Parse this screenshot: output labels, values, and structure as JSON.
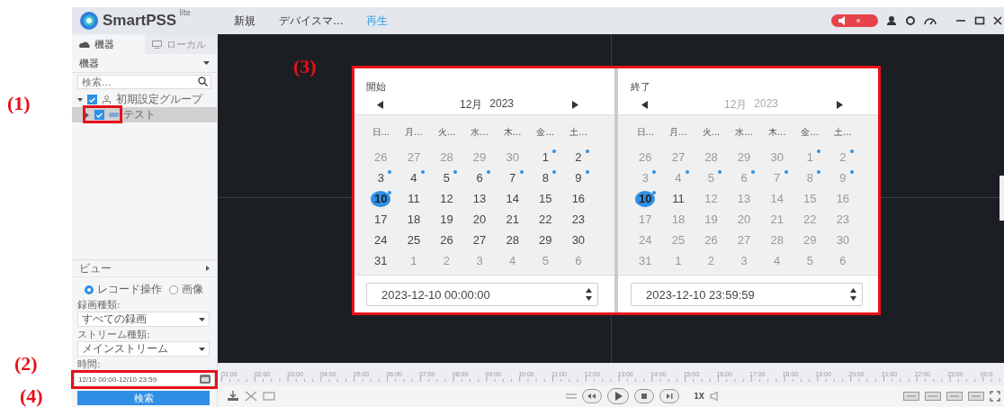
{
  "app": {
    "name": "SmartPSS",
    "edition": "lite"
  },
  "menu": [
    {
      "label": "新規",
      "selected": false
    },
    {
      "label": "デバイスマ...",
      "selected": false
    },
    {
      "label": "再生",
      "selected": true
    }
  ],
  "sidebar": {
    "tabs": [
      {
        "label": "機器",
        "selected": true
      },
      {
        "label": "ローカル",
        "selected": false
      }
    ],
    "device_filter": "機器",
    "search": {
      "placeholder": "検索..."
    },
    "tree": [
      {
        "label": "初期設定グループ",
        "kind": "group",
        "checked": true,
        "expanded": true,
        "selected": false,
        "children": [
          {
            "label": "テスト",
            "kind": "device",
            "checked": true,
            "expanded": false,
            "selected": true
          }
        ]
      }
    ],
    "view_section": "ビュー",
    "modes": [
      {
        "label": "レコード操作",
        "selected": true
      },
      {
        "label": "画像",
        "selected": false
      }
    ],
    "record_type": {
      "label": "録画種類:",
      "value": "すべての録画"
    },
    "stream_type": {
      "label": "ストリーム種類:",
      "value": "メインストリーム"
    },
    "time": {
      "label": "時間:",
      "value": "12/10 00:00-12/10 23:59"
    },
    "search_button": "検索"
  },
  "date_picker": {
    "panels": [
      {
        "title": "開始",
        "month": "12月",
        "year": "2023",
        "header_disabled": false,
        "weekdays": [
          "日...",
          "月...",
          "火...",
          "水...",
          "木...",
          "金...",
          "土..."
        ],
        "time": "2023-12-10 00:00:00",
        "days": [
          {
            "day": "26",
            "muted": true,
            "record": false,
            "selected": false
          },
          {
            "day": "27",
            "muted": true,
            "record": false,
            "selected": false
          },
          {
            "day": "28",
            "muted": true,
            "record": false,
            "selected": false
          },
          {
            "day": "29",
            "muted": true,
            "record": false,
            "selected": false
          },
          {
            "day": "30",
            "muted": true,
            "record": false,
            "selected": false
          },
          {
            "day": "1",
            "muted": false,
            "record": true,
            "selected": false
          },
          {
            "day": "2",
            "muted": false,
            "record": true,
            "selected": false
          },
          {
            "day": "3",
            "muted": false,
            "record": true,
            "selected": false
          },
          {
            "day": "4",
            "muted": false,
            "record": true,
            "selected": false
          },
          {
            "day": "5",
            "muted": false,
            "record": true,
            "selected": false
          },
          {
            "day": "6",
            "muted": false,
            "record": true,
            "selected": false
          },
          {
            "day": "7",
            "muted": false,
            "record": true,
            "selected": false
          },
          {
            "day": "8",
            "muted": false,
            "record": true,
            "selected": false
          },
          {
            "day": "9",
            "muted": false,
            "record": true,
            "selected": false
          },
          {
            "day": "10",
            "muted": false,
            "record": true,
            "selected": true
          },
          {
            "day": "11",
            "muted": false,
            "record": false,
            "selected": false
          },
          {
            "day": "12",
            "muted": false,
            "record": false,
            "selected": false
          },
          {
            "day": "13",
            "muted": false,
            "record": false,
            "selected": false
          },
          {
            "day": "14",
            "muted": false,
            "record": false,
            "selected": false
          },
          {
            "day": "15",
            "muted": false,
            "record": false,
            "selected": false
          },
          {
            "day": "16",
            "muted": false,
            "record": false,
            "selected": false
          },
          {
            "day": "17",
            "muted": false,
            "record": false,
            "selected": false
          },
          {
            "day": "18",
            "muted": false,
            "record": false,
            "selected": false
          },
          {
            "day": "19",
            "muted": false,
            "record": false,
            "selected": false
          },
          {
            "day": "20",
            "muted": false,
            "record": false,
            "selected": false
          },
          {
            "day": "21",
            "muted": false,
            "record": false,
            "selected": false
          },
          {
            "day": "22",
            "muted": false,
            "record": false,
            "selected": false
          },
          {
            "day": "23",
            "muted": false,
            "record": false,
            "selected": false
          },
          {
            "day": "24",
            "muted": false,
            "record": false,
            "selected": false
          },
          {
            "day": "25",
            "muted": false,
            "record": false,
            "selected": false
          },
          {
            "day": "26",
            "muted": false,
            "record": false,
            "selected": false
          },
          {
            "day": "27",
            "muted": false,
            "record": false,
            "selected": false
          },
          {
            "day": "28",
            "muted": false,
            "record": false,
            "selected": false
          },
          {
            "day": "29",
            "muted": false,
            "record": false,
            "selected": false
          },
          {
            "day": "30",
            "muted": false,
            "record": false,
            "selected": false
          },
          {
            "day": "31",
            "muted": false,
            "record": false,
            "selected": false
          },
          {
            "day": "1",
            "muted": true,
            "record": false,
            "selected": false
          },
          {
            "day": "2",
            "muted": true,
            "record": false,
            "selected": false
          },
          {
            "day": "3",
            "muted": true,
            "record": false,
            "selected": false
          },
          {
            "day": "4",
            "muted": true,
            "record": false,
            "selected": false
          },
          {
            "day": "5",
            "muted": true,
            "record": false,
            "selected": false
          },
          {
            "day": "6",
            "muted": true,
            "record": false,
            "selected": false
          }
        ]
      },
      {
        "title": "終了",
        "month": "12月",
        "year": "2023",
        "header_disabled": true,
        "weekdays": [
          "日...",
          "月...",
          "火...",
          "水...",
          "木...",
          "金...",
          "土..."
        ],
        "time": "2023-12-10 23:59:59",
        "days": [
          {
            "day": "26",
            "muted": true,
            "record": false,
            "selected": false
          },
          {
            "day": "27",
            "muted": true,
            "record": false,
            "selected": false
          },
          {
            "day": "28",
            "muted": true,
            "record": false,
            "selected": false
          },
          {
            "day": "29",
            "muted": true,
            "record": false,
            "selected": false
          },
          {
            "day": "30",
            "muted": true,
            "record": false,
            "selected": false
          },
          {
            "day": "1",
            "muted": true,
            "record": true,
            "selected": false
          },
          {
            "day": "2",
            "muted": true,
            "record": true,
            "selected": false
          },
          {
            "day": "3",
            "muted": true,
            "record": true,
            "selected": false
          },
          {
            "day": "4",
            "muted": true,
            "record": true,
            "selected": false
          },
          {
            "day": "5",
            "muted": true,
            "record": true,
            "selected": false
          },
          {
            "day": "6",
            "muted": true,
            "record": true,
            "selected": false
          },
          {
            "day": "7",
            "muted": true,
            "record": true,
            "selected": false
          },
          {
            "day": "8",
            "muted": true,
            "record": true,
            "selected": false
          },
          {
            "day": "9",
            "muted": true,
            "record": true,
            "selected": false
          },
          {
            "day": "10",
            "muted": false,
            "record": true,
            "selected": true
          },
          {
            "day": "11",
            "muted": false,
            "record": false,
            "selected": false
          },
          {
            "day": "12",
            "muted": true,
            "record": false,
            "selected": false
          },
          {
            "day": "13",
            "muted": true,
            "record": false,
            "selected": false
          },
          {
            "day": "14",
            "muted": true,
            "record": false,
            "selected": false
          },
          {
            "day": "15",
            "muted": true,
            "record": false,
            "selected": false
          },
          {
            "day": "16",
            "muted": true,
            "record": false,
            "selected": false
          },
          {
            "day": "17",
            "muted": true,
            "record": false,
            "selected": false
          },
          {
            "day": "18",
            "muted": true,
            "record": false,
            "selected": false
          },
          {
            "day": "19",
            "muted": true,
            "record": false,
            "selected": false
          },
          {
            "day": "20",
            "muted": true,
            "record": false,
            "selected": false
          },
          {
            "day": "21",
            "muted": true,
            "record": false,
            "selected": false
          },
          {
            "day": "22",
            "muted": true,
            "record": false,
            "selected": false
          },
          {
            "day": "23",
            "muted": true,
            "record": false,
            "selected": false
          },
          {
            "day": "24",
            "muted": true,
            "record": false,
            "selected": false
          },
          {
            "day": "25",
            "muted": true,
            "record": false,
            "selected": false
          },
          {
            "day": "26",
            "muted": true,
            "record": false,
            "selected": false
          },
          {
            "day": "27",
            "muted": true,
            "record": false,
            "selected": false
          },
          {
            "day": "28",
            "muted": true,
            "record": false,
            "selected": false
          },
          {
            "day": "29",
            "muted": true,
            "record": false,
            "selected": false
          },
          {
            "day": "30",
            "muted": true,
            "record": false,
            "selected": false
          },
          {
            "day": "31",
            "muted": true,
            "record": false,
            "selected": false
          },
          {
            "day": "1",
            "muted": true,
            "record": false,
            "selected": false
          },
          {
            "day": "2",
            "muted": true,
            "record": false,
            "selected": false
          },
          {
            "day": "3",
            "muted": true,
            "record": false,
            "selected": false
          },
          {
            "day": "4",
            "muted": true,
            "record": false,
            "selected": false
          },
          {
            "day": "5",
            "muted": true,
            "record": false,
            "selected": false
          },
          {
            "day": "6",
            "muted": true,
            "record": false,
            "selected": false
          }
        ]
      }
    ]
  },
  "timeline": {
    "ticks": [
      "01:00",
      "02:00",
      "03:00",
      "04:00",
      "05:00",
      "06:00",
      "07:00",
      "08:00",
      "09:00",
      "10:00",
      "11:00",
      "12:00",
      "13:00",
      "14:00",
      "15:00",
      "16:00",
      "17:00",
      "18:00",
      "19:00",
      "20:00",
      "21:00",
      "22:00",
      "23:00",
      "00:0"
    ]
  },
  "playback": {
    "speed": "1X"
  },
  "annotations": [
    {
      "label": "(1)"
    },
    {
      "label": "(2)"
    },
    {
      "label": "(3)"
    },
    {
      "label": "(4)"
    }
  ]
}
